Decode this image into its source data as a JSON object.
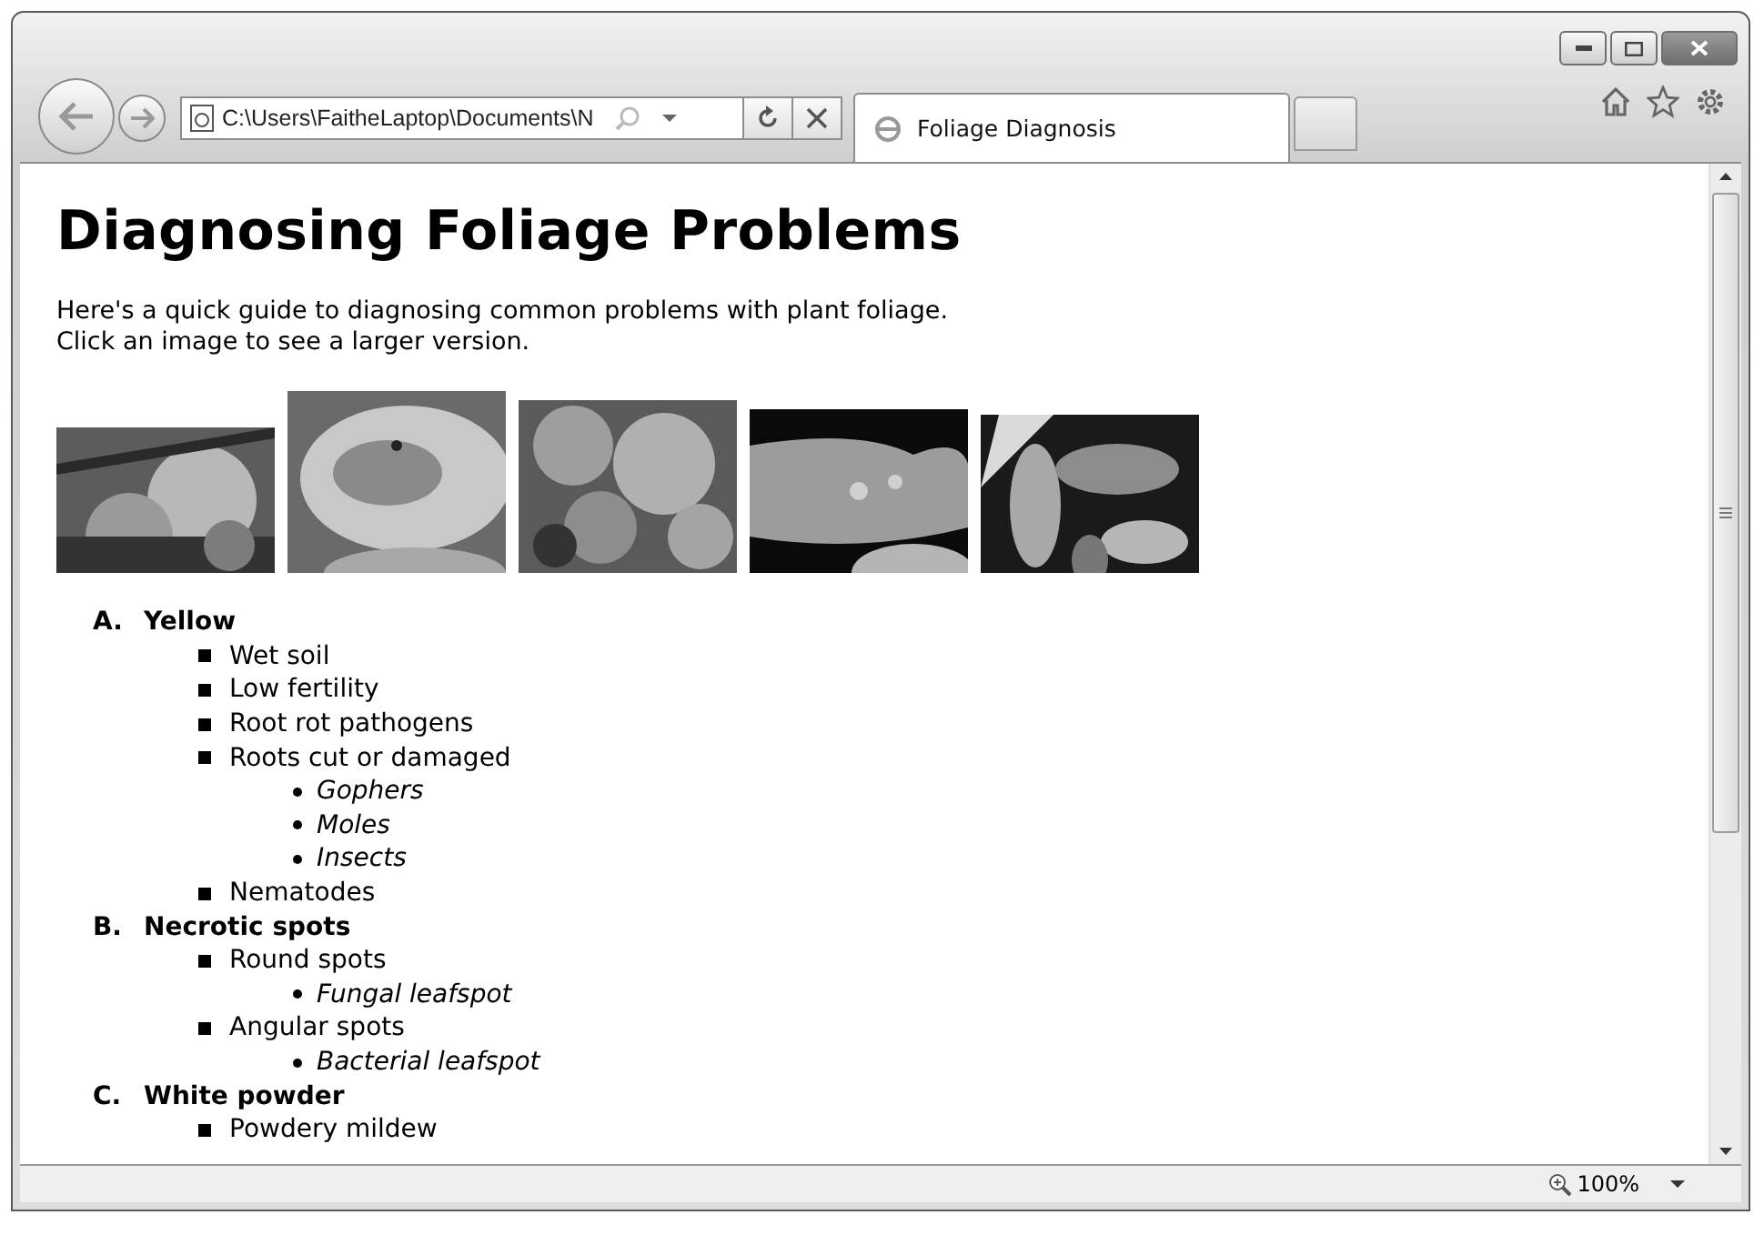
{
  "address_bar": {
    "value": "C:\\Users\\FaitheLaptop\\Documents\\N"
  },
  "tabs": [
    {
      "label": "Foliage Diagnosis",
      "selected": true
    }
  ],
  "page": {
    "heading": "Diagnosing Foliage Problems",
    "intro": [
      "Here's a quick guide to diagnosing common problems with plant foliage.",
      "Click an image to see a larger version."
    ],
    "images": [
      {
        "kind": "picture"
      },
      {
        "kind": "picture"
      },
      {
        "kind": "picture"
      },
      {
        "kind": "picture"
      },
      {
        "kind": "picture"
      }
    ],
    "outline": [
      {
        "marker": "A.",
        "text": "Yellow",
        "children": [
          {
            "text": "Wet soil"
          },
          {
            "text": "Low fertility"
          },
          {
            "text": "Root rot pathogens"
          },
          {
            "text": "Roots cut or damaged",
            "children": [
              {
                "text": "Gophers"
              },
              {
                "text": "Moles"
              },
              {
                "text": "Insects"
              }
            ]
          },
          {
            "text": "Nematodes"
          }
        ]
      },
      {
        "marker": "B.",
        "text": "Necrotic spots",
        "children": [
          {
            "text": "Round spots",
            "children": [
              {
                "text": "Fungal leafspot"
              }
            ]
          },
          {
            "text": "Angular spots",
            "children": [
              {
                "text": "Bacterial leafspot"
              }
            ]
          }
        ]
      },
      {
        "marker": "C.",
        "text": "White powder",
        "children": [
          {
            "text": "Powdery mildew"
          }
        ]
      }
    ]
  },
  "status_bar": {
    "zoom": "100%"
  }
}
